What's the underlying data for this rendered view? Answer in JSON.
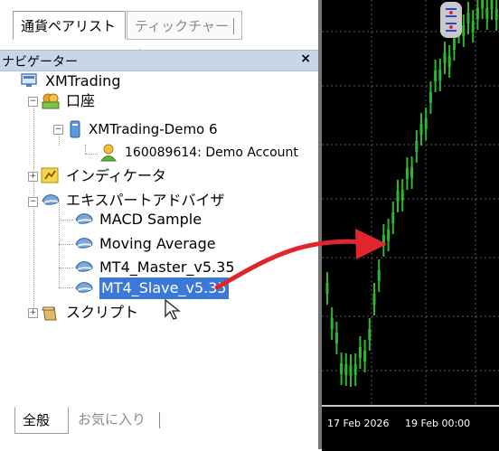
{
  "market_tabs": [
    "通貨ペアリスト",
    "ティックチャート"
  ],
  "navigator": {
    "title": "ナビゲーター",
    "close": "×"
  },
  "tree": {
    "root": "XMTrading",
    "accounts_folder": "口座",
    "server": "XMTrading-Demo 6",
    "account": "160089614: Demo Account",
    "indicators": "インディケータ",
    "expert_advisors": "エキスパートアドバイザ",
    "ea_items": [
      "MACD Sample",
      "Moving Average",
      "MT4_Master_v5.35",
      "MT4_Slave_v5.35"
    ],
    "scripts": "スクリプト"
  },
  "bottom_tabs": [
    "全般",
    "お気に入り"
  ],
  "chart": {
    "dates": [
      "17 Feb 2026",
      "19 Feb 00:00"
    ],
    "candle_color": "#2fb82f",
    "background": "#000000"
  },
  "colors": {
    "selection": "#3b78d8",
    "arrow": "#e0262d",
    "header": "#c8d6e8"
  }
}
